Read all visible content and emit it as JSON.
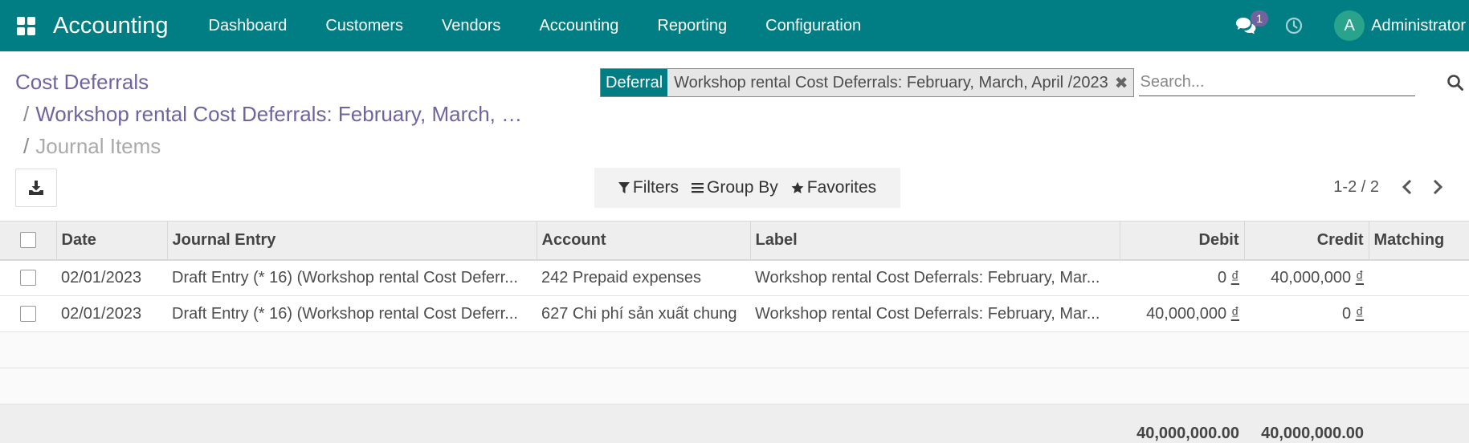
{
  "navbar": {
    "app_title": "Accounting",
    "menu": [
      "Dashboard",
      "Customers",
      "Vendors",
      "Accounting",
      "Reporting",
      "Configuration"
    ],
    "chat_badge": "1",
    "user_initial": "A",
    "user_name": "Administrator",
    "bg_color": "#017e84"
  },
  "breadcrumb": {
    "root": "Cost Deferrals",
    "middle": "Workshop rental Cost Deferrals: February, March, …",
    "separator": "/",
    "current": "Journal Items"
  },
  "search": {
    "facet_label": "Deferral",
    "facet_value": "Workshop rental Cost Deferrals: February, March, April /2023",
    "placeholder": "Search..."
  },
  "filters": {
    "filters_label": "Filters",
    "group_by_label": "Group By",
    "favorites_label": "Favorites"
  },
  "pager": {
    "value": "1-2 / 2"
  },
  "table": {
    "columns": {
      "date": "Date",
      "journal_entry": "Journal Entry",
      "account": "Account",
      "label": "Label",
      "debit": "Debit",
      "credit": "Credit",
      "matching": "Matching"
    },
    "rows": [
      {
        "date": "02/01/2023",
        "journal_entry": "Draft Entry (* 16) (Workshop rental Cost Deferr...",
        "account": "242 Prepaid expenses",
        "label": "Workshop rental Cost Deferrals: February, Mar...",
        "debit": "0",
        "credit": "40,000,000",
        "matching": ""
      },
      {
        "date": "02/01/2023",
        "journal_entry": "Draft Entry (* 16) (Workshop rental Cost Deferr...",
        "account": "627 Chi phí sản xuất chung",
        "label": "Workshop rental Cost Deferrals: February, Mar...",
        "debit": "40,000,000",
        "credit": "0",
        "matching": ""
      }
    ],
    "currency_symbol": "₫",
    "totals": {
      "debit": "40,000,000.00",
      "credit": "40,000,000.00"
    }
  }
}
